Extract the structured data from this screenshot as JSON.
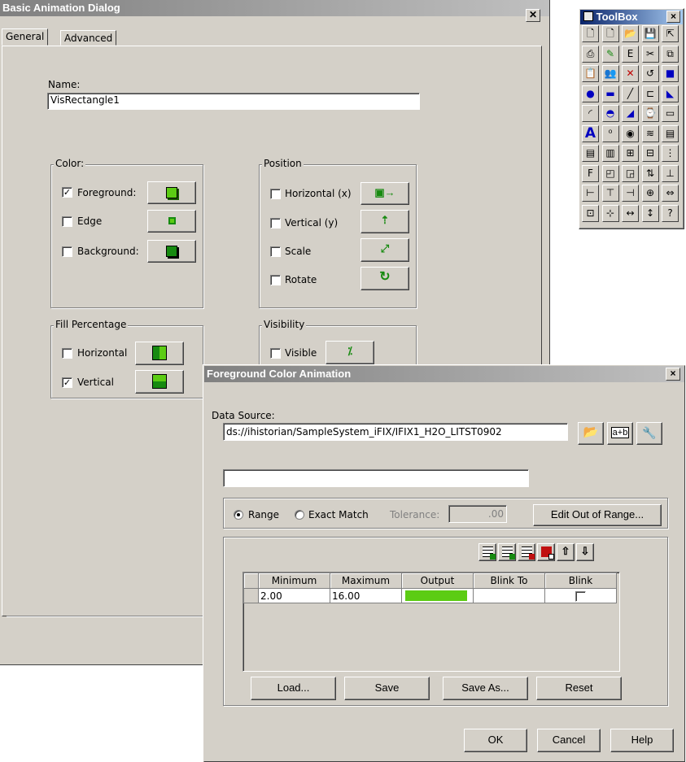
{
  "basic_dialog": {
    "title": "Basic Animation Dialog",
    "tabs": [
      "General",
      "Advanced"
    ],
    "name_label": "Name:",
    "name_value": "VisRectangle1",
    "color_group": {
      "label": "Color:",
      "items": [
        {
          "label": "Foreground:",
          "checked": true
        },
        {
          "label": "Edge",
          "checked": false
        },
        {
          "label": "Background:",
          "checked": false
        }
      ]
    },
    "position_group": {
      "label": "Position",
      "items": [
        {
          "label": "Horizontal (x)",
          "checked": false
        },
        {
          "label": "Vertical (y)",
          "checked": false
        },
        {
          "label": "Scale",
          "checked": false
        },
        {
          "label": "Rotate",
          "checked": false
        }
      ]
    },
    "fill_group": {
      "label": "Fill Percentage",
      "items": [
        {
          "label": "Horizontal",
          "checked": false
        },
        {
          "label": "Vertical",
          "checked": true
        }
      ]
    },
    "visibility_group": {
      "label": "Visibility",
      "items": [
        {
          "label": "Visible",
          "checked": false
        }
      ]
    }
  },
  "toolbox": {
    "title": "ToolBox",
    "close": "×"
  },
  "fg_dialog": {
    "title": "Foreground Color Animation",
    "close": "×",
    "data_source_label": "Data Source:",
    "data_source_value": "ds://ihistorian/SampleSystem_iFIX/IFIX1_H2O_LITST0902",
    "range_label": "Range",
    "exact_match_label": "Exact Match",
    "tolerance_label": "Tolerance:",
    "tolerance_value": ".00",
    "edit_out_of_range": "Edit Out of Range...",
    "table": {
      "headers": [
        "Minimum",
        "Maximum",
        "Output",
        "Blink To",
        "Blink"
      ],
      "rows": [
        {
          "minimum": "2.00",
          "maximum": "16.00",
          "output_color": "#5ccc14",
          "blink": false
        }
      ]
    },
    "load": "Load...",
    "save": "Save",
    "save_as": "Save As...",
    "reset": "Reset",
    "ok": "OK",
    "cancel": "Cancel",
    "help": "Help"
  },
  "colors": {
    "accent_green": "#5ccc14",
    "dialog_face": "#d4d0c8"
  },
  "icons": {
    "toolbox_tools": [
      "new-doc-icon",
      "new-picture-icon",
      "open-folder-icon",
      "save-icon",
      "import-icon",
      "print-icon",
      "run-icon",
      "tree-icon",
      "cut-icon",
      "copy-icon",
      "paste-icon",
      "users-icon",
      "delete-icon",
      "undo-icon",
      "rectangle-icon",
      "ellipse-icon",
      "rounded-rect-icon",
      "line-icon",
      "polyline-icon",
      "polygon-icon",
      "arc-icon",
      "chord-icon",
      "pie-icon",
      "timer-icon",
      "round-rect-outline-icon",
      "text-icon",
      "datalink-icon",
      "ole-icon",
      "chart-icon",
      "alarm-summary-icon",
      "list-icon",
      "variable-icon",
      "group-icon",
      "ungroup-icon",
      "layers-icon",
      "font-icon",
      "bring-front-icon",
      "send-back-icon",
      "align-icon",
      "align-bottom-icon",
      "align-left-icon",
      "align-top-icon",
      "align-right-icon",
      "center-icon",
      "space-icon",
      "grid-icon",
      "snap-icon",
      "width-icon",
      "height-icon",
      "help-icon"
    ]
  }
}
